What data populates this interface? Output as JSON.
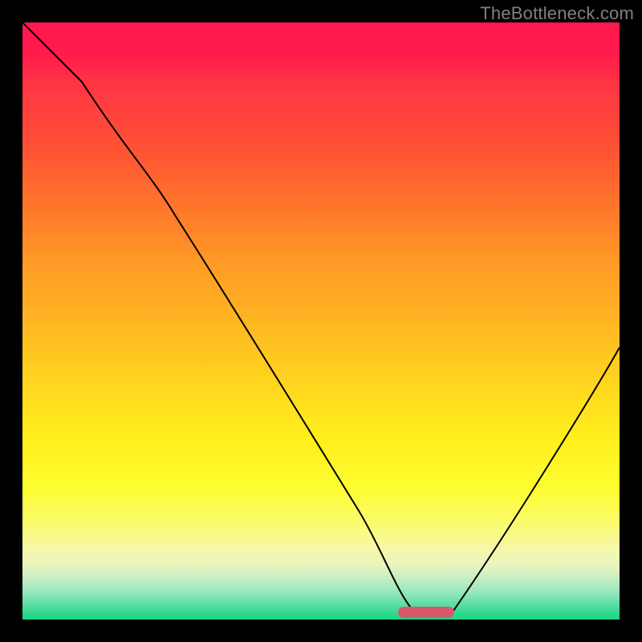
{
  "watermark": "TheBottleneck.com",
  "chart_data": {
    "type": "line",
    "title": "",
    "xlabel": "",
    "ylabel": "",
    "xlim": [
      0,
      100
    ],
    "ylim": [
      0,
      100
    ],
    "grid": false,
    "legend": false,
    "background_gradient": {
      "top": "#ff1a4d",
      "bottom": "#1ad884",
      "description": "red-orange-yellow-green vertical gradient inside black frame"
    },
    "series": [
      {
        "name": "bottleneck-curve",
        "x": [
          0,
          10,
          22,
          30,
          40,
          50,
          60,
          63,
          68,
          72,
          78,
          88,
          100
        ],
        "y": [
          100,
          90,
          75,
          67,
          53,
          39,
          25,
          10,
          1,
          1,
          10,
          28,
          50
        ]
      }
    ],
    "marker": {
      "name": "optimal-range",
      "shape": "rounded-bar",
      "color": "#d9596a",
      "x_range": [
        63,
        72
      ],
      "y": 0.8
    }
  }
}
